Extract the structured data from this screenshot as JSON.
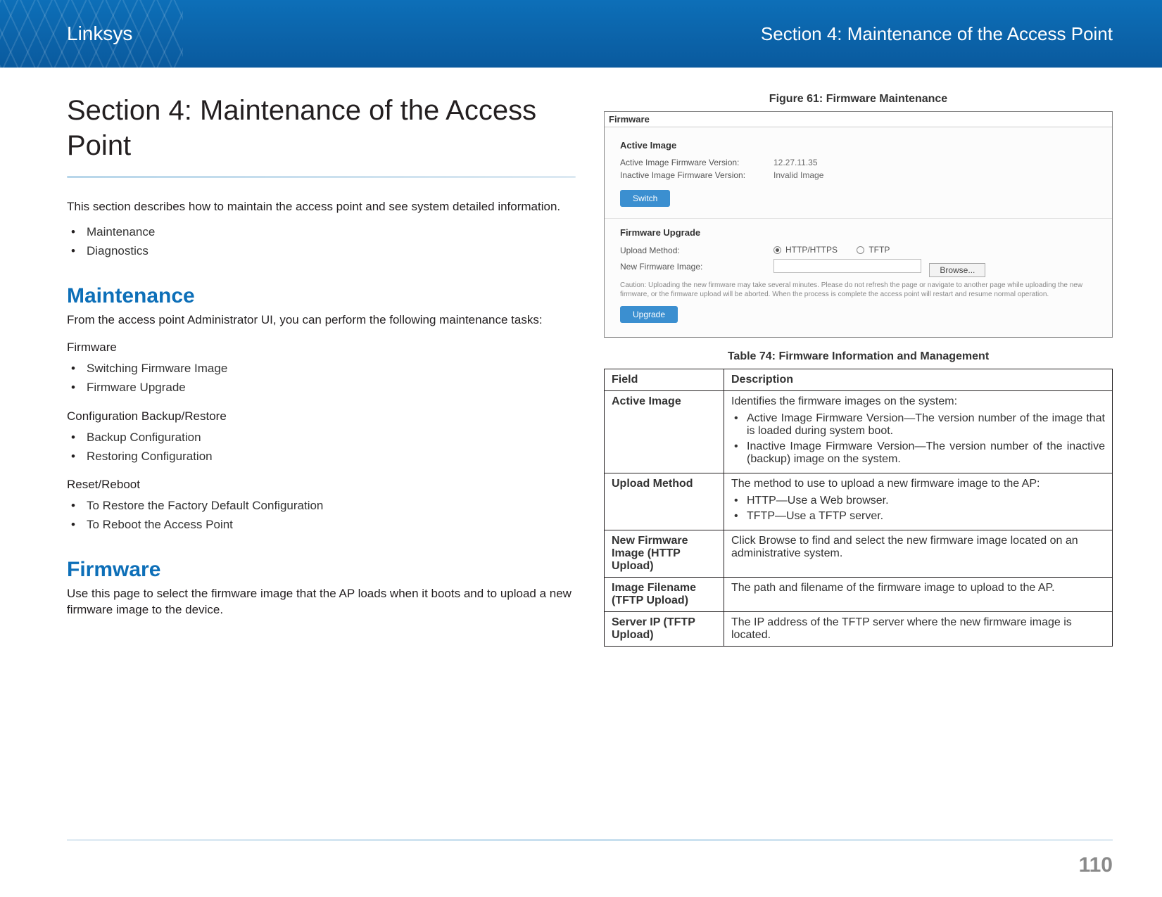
{
  "header": {
    "brand": "Linksys",
    "section": "Section 4: Maintenance of the Access Point"
  },
  "left": {
    "title": "Section 4: Maintenance of the Access Point",
    "intro": "This section describes how to maintain the access point and see system detailed information.",
    "intro_items": [
      "Maintenance",
      "Diagnostics"
    ],
    "maintenance_heading": "Maintenance",
    "maintenance_text": "From the access point Administrator UI, you can perform the following maintenance tasks:",
    "group1_label": "Firmware",
    "group1_items": [
      "Switching Firmware Image",
      "Firmware Upgrade"
    ],
    "group2_label": "Configuration Backup/Restore",
    "group2_items": [
      "Backup Configuration",
      "Restoring Configuration"
    ],
    "group3_label": "Reset/Reboot",
    "group3_items": [
      "To Restore the Factory Default Configuration",
      "To Reboot the Access Point"
    ],
    "firmware_heading": "Firmware",
    "firmware_text": "Use this page to select the firmware image that the AP loads when it boots and to upload a new firmware image to the device."
  },
  "figure": {
    "caption": "Figure 61: Firmware Maintenance",
    "panel_title": "Firmware",
    "active_heading": "Active Image",
    "row1_label": "Active Image Firmware Version:",
    "row1_value": "12.27.11.35",
    "row2_label": "Inactive Image Firmware Version:",
    "row2_value": "Invalid Image",
    "switch_btn": "Switch",
    "upgrade_heading": "Firmware Upgrade",
    "upload_label": "Upload Method:",
    "radio_http": "HTTP/HTTPS",
    "radio_tftp": "TFTP",
    "newimg_label": "New Firmware Image:",
    "browse_btn": "Browse...",
    "caution": "Caution: Uploading the new firmware may take several minutes. Please do not refresh the page or navigate to another page while uploading the new firmware, or the firmware upload will be aborted. When the process is complete the access point will restart and resume normal operation.",
    "upgrade_btn": "Upgrade"
  },
  "table": {
    "caption": "Table 74: Firmware Information and Management",
    "header_field": "Field",
    "header_desc": "Description",
    "rows": [
      {
        "field": "Active Image",
        "desc": "Identifies the firmware images on the system:",
        "items": [
          "Active Image Firmware Version—The version number of the image that is loaded during system boot.",
          "Inactive Image Firmware Version—The version number of the inactive (backup) image on the system."
        ]
      },
      {
        "field": "Upload Method",
        "desc": "The method to use to upload a new firmware image to the AP:",
        "items": [
          "HTTP—Use a Web browser.",
          "TFTP—Use a TFTP server."
        ]
      },
      {
        "field": "New Firmware Image (HTTP Upload)",
        "desc": "Click Browse to find and select the new firmware image located on an administrative system."
      },
      {
        "field": "Image Filename (TFTP Upload)",
        "desc": "The path and filename of the firmware image to upload to the AP."
      },
      {
        "field": "Server IP (TFTP Upload)",
        "desc": "The IP address of the TFTP server where the new firmware image is located."
      }
    ]
  },
  "page_number": "110"
}
